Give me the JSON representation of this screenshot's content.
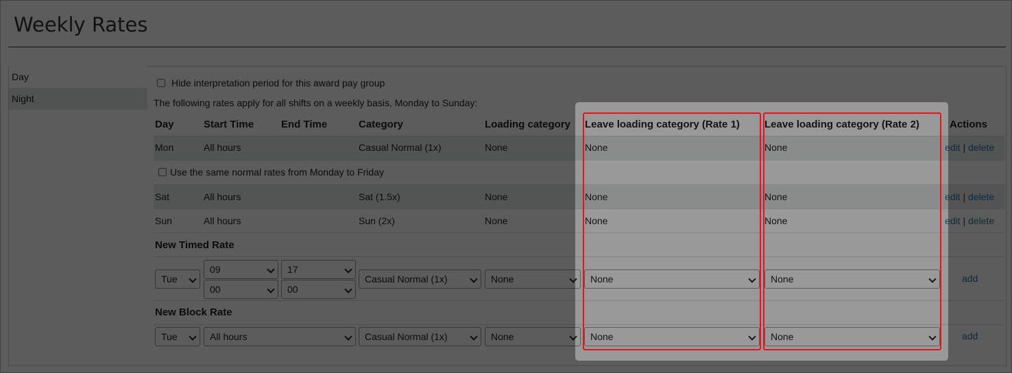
{
  "page": {
    "title": "Weekly Rates"
  },
  "sidebar": {
    "items": [
      {
        "label": "Day"
      },
      {
        "label": "Night"
      }
    ]
  },
  "hide_interpretation": {
    "label": "Hide interpretation period for this award pay group",
    "checked": false
  },
  "intro": "The following rates apply for all shifts on a weekly basis, Monday to Sunday:",
  "columns": [
    "Day",
    "Start Time",
    "End Time",
    "Category",
    "Loading category",
    "Leave loading category (Rate 1)",
    "Leave loading category (Rate 2)",
    "Actions"
  ],
  "rows": [
    {
      "day": "Mon",
      "start": "All hours",
      "end": "",
      "category": "Casual Normal (1x)",
      "loading": "None",
      "leave1": "None",
      "leave2": "None"
    },
    {
      "day": "Sat",
      "start": "All hours",
      "end": "",
      "category": "Sat (1.5x)",
      "loading": "None",
      "leave1": "None",
      "leave2": "None"
    },
    {
      "day": "Sun",
      "start": "All hours",
      "end": "",
      "category": "Sun (2x)",
      "loading": "None",
      "leave1": "None",
      "leave2": "None"
    }
  ],
  "same_rates": {
    "label": "Use the same normal rates from Monday to Friday",
    "checked": false
  },
  "actions": {
    "edit": "edit",
    "sep": "|",
    "delete": "delete",
    "add": "add"
  },
  "new_timed_rate": {
    "heading": "New Timed Rate",
    "day": "Tue",
    "start_hour": "09",
    "start_minute": "00",
    "end_hour": "17",
    "end_minute": "00",
    "category": "Casual Normal (1x)",
    "loading": "None",
    "leave1": "None",
    "leave2": "None"
  },
  "new_block_rate": {
    "heading": "New Block Rate",
    "day": "Tue",
    "hours": "All hours",
    "category": "Casual Normal (1x)",
    "loading": "None",
    "leave1": "None",
    "leave2": "None"
  },
  "colors": {
    "highlight": "#e8141c",
    "link": "#1e7aa0",
    "shaded_row": "#e7eaea"
  }
}
